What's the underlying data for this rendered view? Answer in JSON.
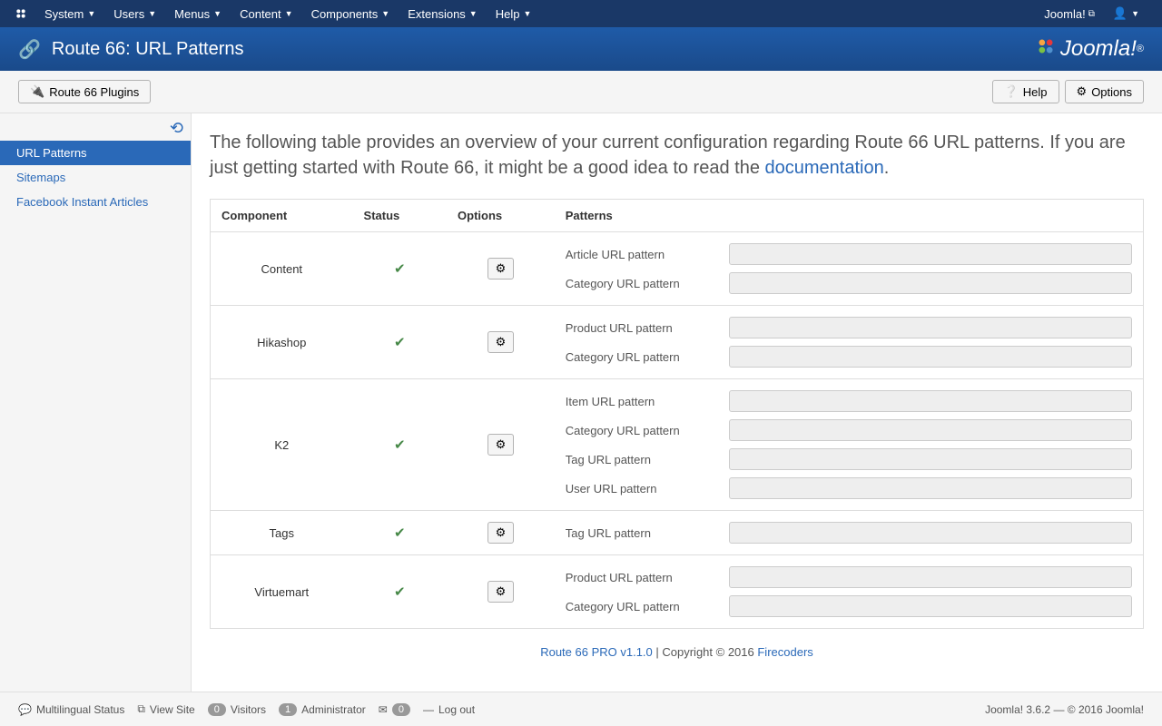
{
  "topnav": {
    "left": [
      "System",
      "Users",
      "Menus",
      "Content",
      "Components",
      "Extensions",
      "Help"
    ],
    "right_site": "Joomla!"
  },
  "header": {
    "title": "Route 66: URL Patterns",
    "brand": "Joomla!"
  },
  "toolbar": {
    "plugins_btn": "Route 66 Plugins",
    "help_btn": "Help",
    "options_btn": "Options"
  },
  "sidebar": {
    "items": [
      "URL Patterns",
      "Sitemaps",
      "Facebook Instant Articles"
    ],
    "active_index": 0
  },
  "intro": {
    "text_before": "The following table provides an overview of your current configuration regarding Route 66 URL patterns. If you are just getting started with Route 66, it might be a good idea to read the ",
    "link": "documentation",
    "text_after": "."
  },
  "table": {
    "headers": [
      "Component",
      "Status",
      "Options",
      "Patterns"
    ],
    "rows": [
      {
        "component": "Content",
        "patterns": [
          "Article URL pattern",
          "Category URL pattern"
        ]
      },
      {
        "component": "Hikashop",
        "patterns": [
          "Product URL pattern",
          "Category URL pattern"
        ]
      },
      {
        "component": "K2",
        "patterns": [
          "Item URL pattern",
          "Category URL pattern",
          "Tag URL pattern",
          "User URL pattern"
        ]
      },
      {
        "component": "Tags",
        "patterns": [
          "Tag URL pattern"
        ]
      },
      {
        "component": "Virtuemart",
        "patterns": [
          "Product URL pattern",
          "Category URL pattern"
        ]
      }
    ]
  },
  "credits": {
    "product": "Route 66 PRO v1.1.0",
    "copyright": " | Copyright © 2016 ",
    "company": "Firecoders"
  },
  "statusbar": {
    "multilingual": "Multilingual Status",
    "view_site": "View Site",
    "visitors_count": "0",
    "visitors": "Visitors",
    "admin_count": "1",
    "admin": "Administrator",
    "msg_count": "0",
    "logout": "Log out",
    "right": "Joomla! 3.6.2  —  © 2016 Joomla!"
  }
}
